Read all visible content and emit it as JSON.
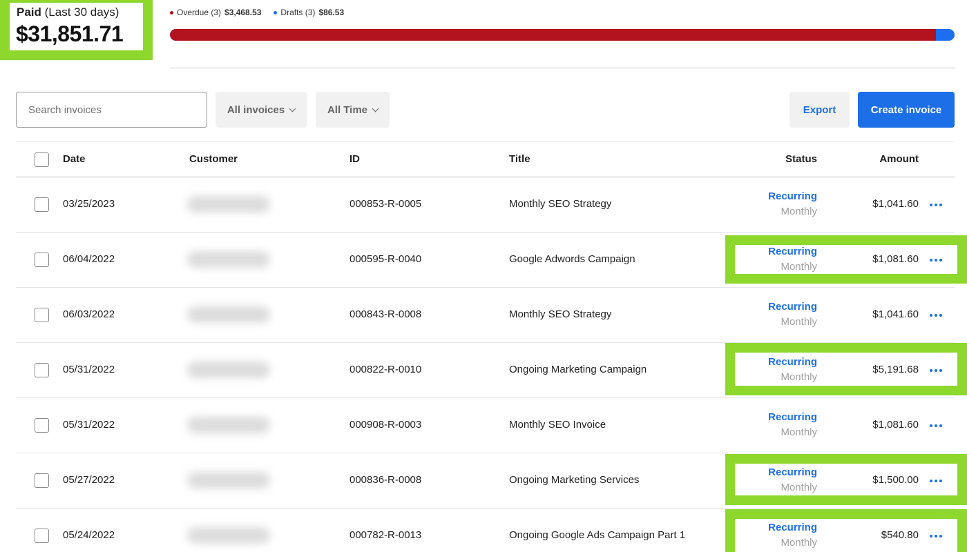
{
  "summary": {
    "paid_label": "Paid",
    "paid_period": "(Last 30 days)",
    "paid_amount": "$31,851.71",
    "overdue_label": "Overdue (3)",
    "overdue_amount": "$3,468.53",
    "drafts_label": "Drafts (3)",
    "drafts_amount": "$86.53",
    "bar_fraction_overdue": 0.976
  },
  "colors": {
    "overdue": "#b3121f",
    "drafts": "#1e6ef0",
    "accent": "#1c6fe6",
    "highlight": "#8ed72c"
  },
  "toolbar": {
    "search_placeholder": "Search invoices",
    "filter_invoices": "All invoices",
    "filter_time": "All Time",
    "export_label": "Export",
    "create_label": "Create invoice"
  },
  "table": {
    "headers": {
      "date": "Date",
      "customer": "Customer",
      "id": "ID",
      "title": "Title",
      "status": "Status",
      "amount": "Amount"
    },
    "rows": [
      {
        "date": "03/25/2023",
        "id": "000853-R-0005",
        "title": "Monthly SEO Strategy",
        "status": "Recurring",
        "frequency": "Monthly",
        "amount": "$1,041.60"
      },
      {
        "date": "06/04/2022",
        "id": "000595-R-0040",
        "title": "Google Adwords Campaign",
        "status": "Recurring",
        "frequency": "Monthly",
        "amount": "$1,081.60"
      },
      {
        "date": "06/03/2022",
        "id": "000843-R-0008",
        "title": "Monthly SEO Strategy",
        "status": "Recurring",
        "frequency": "Monthly",
        "amount": "$1,041.60"
      },
      {
        "date": "05/31/2022",
        "id": "000822-R-0010",
        "title": "Ongoing Marketing Campaign",
        "status": "Recurring",
        "frequency": "Monthly",
        "amount": "$5,191.68"
      },
      {
        "date": "05/31/2022",
        "id": "000908-R-0003",
        "title": "Monthly SEO Invoice",
        "status": "Recurring",
        "frequency": "Monthly",
        "amount": "$1,081.60"
      },
      {
        "date": "05/27/2022",
        "id": "000836-R-0008",
        "title": "Ongoing Marketing Services",
        "status": "Recurring",
        "frequency": "Monthly",
        "amount": "$1,500.00"
      },
      {
        "date": "05/24/2022",
        "id": "000782-R-0013",
        "title": "Ongoing Google Ads Campaign Part 1",
        "status": "Recurring",
        "frequency": "Monthly",
        "amount": "$540.80"
      }
    ]
  }
}
